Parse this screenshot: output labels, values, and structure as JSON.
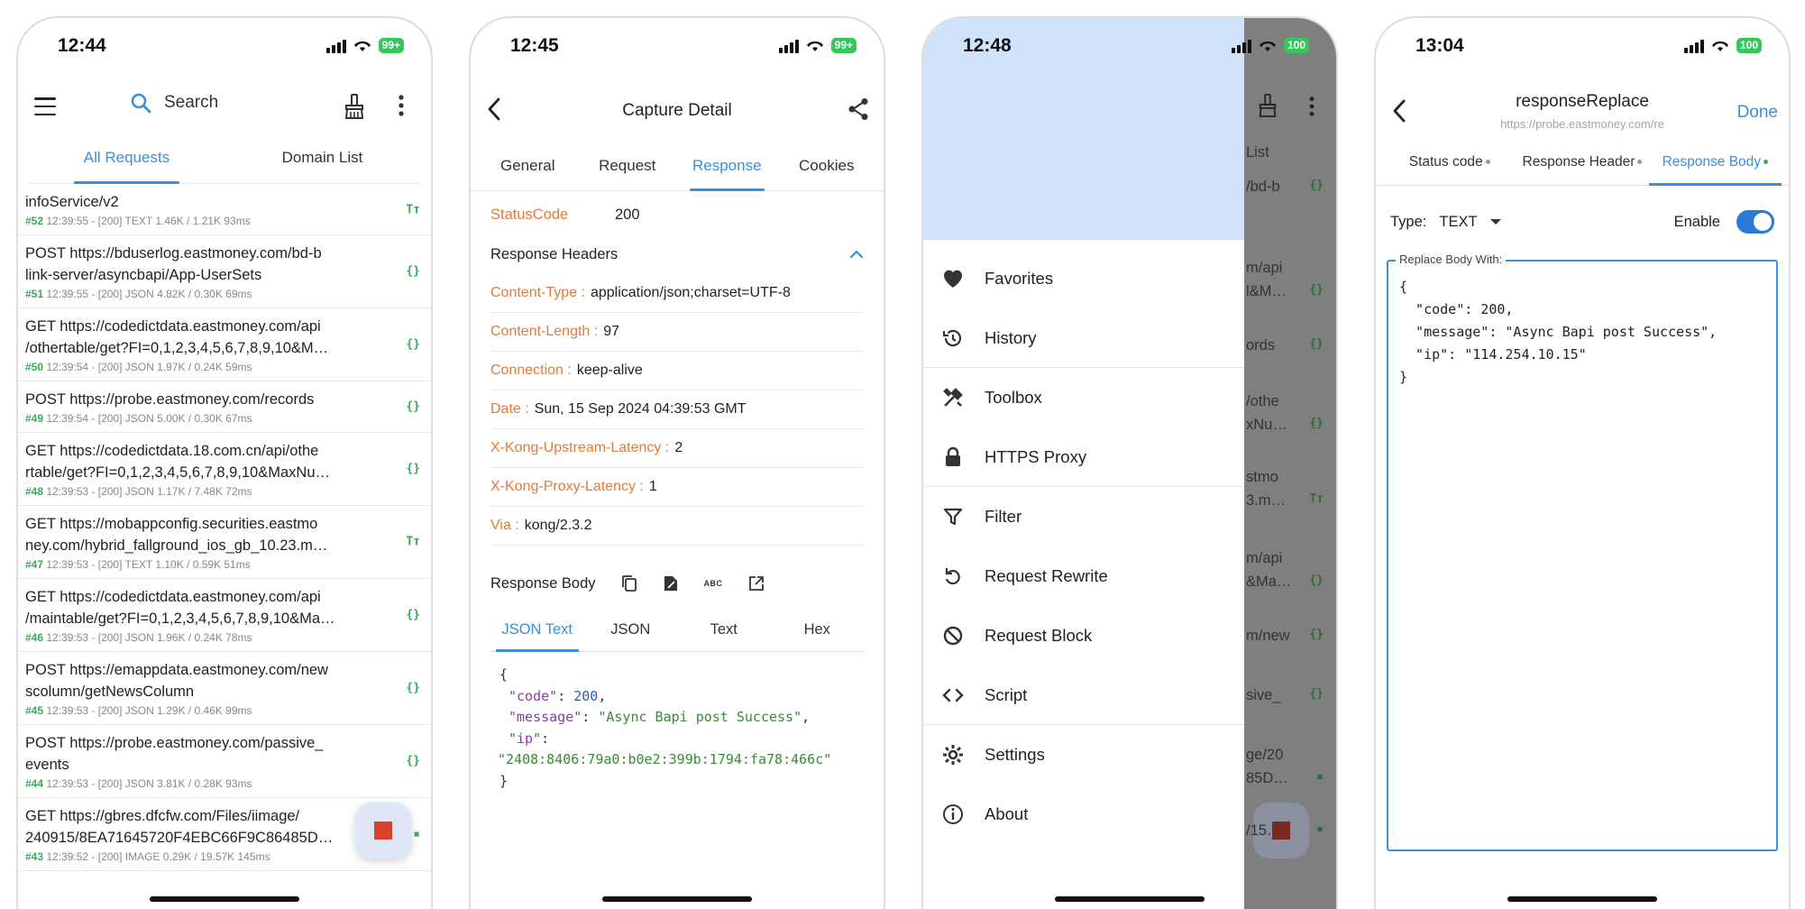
{
  "phone1": {
    "time": "12:44",
    "battery": "99+",
    "search_label": "Search",
    "tabs": [
      "All Requests",
      "Domain List"
    ],
    "requests": [
      {
        "url": "infoService/v2",
        "id": "#52",
        "meta": " 12:39:55 - [200] TEXT 1.46K / 1.21K  93ms",
        "icon": "Tт"
      },
      {
        "url": "POST https://bduserlog.eastmoney.com/bd-b\nlink-server/asyncbapi/App-UserSets",
        "id": "#51",
        "meta": " 12:39:55 - [200] JSON 4.82K / 0.30K  69ms",
        "icon": "{}"
      },
      {
        "url": "GET https://codedictdata.eastmoney.com/api\n/othertable/get?FI=0,1,2,3,4,5,6,7,8,9,10&M…",
        "id": "#50",
        "meta": " 12:39:54 - [200] JSON 1.97K / 0.24K  59ms",
        "icon": "{}"
      },
      {
        "url": "POST https://probe.eastmoney.com/records",
        "id": "#49",
        "meta": " 12:39:54 - [200] JSON 5.00K / 0.30K  67ms",
        "icon": "{}"
      },
      {
        "url": "GET https://codedictdata.18.com.cn/api/othe\nrtable/get?FI=0,1,2,3,4,5,6,7,8,9,10&MaxNu…",
        "id": "#48",
        "meta": " 12:39:53 - [200] JSON 1.17K / 7.48K  72ms",
        "icon": "{}"
      },
      {
        "url": "GET https://mobappconfig.securities.eastmo\nney.com/hybrid_fallground_ios_gb_10.23.m…",
        "id": "#47",
        "meta": " 12:39:53 - [200] TEXT 1.10K / 0.59K  51ms",
        "icon": "Tт"
      },
      {
        "url": "GET https://codedictdata.eastmoney.com/api\n/maintable/get?FI=0,1,2,3,4,5,6,7,8,9,10&Ma…",
        "id": "#46",
        "meta": " 12:39:53 - [200] JSON 1.96K / 0.24K  78ms",
        "icon": "{}"
      },
      {
        "url": "POST https://emappdata.eastmoney.com/new\nscolumn/getNewsColumn",
        "id": "#45",
        "meta": " 12:39:53 - [200] JSON 1.29K / 0.46K  99ms",
        "icon": "{}"
      },
      {
        "url": "POST https://probe.eastmoney.com/passive_\nevents",
        "id": "#44",
        "meta": " 12:39:53 - [200] JSON 3.81K / 0.28K  93ms",
        "icon": "{}"
      },
      {
        "url": "GET https://gbres.dfcfw.com/Files/iimage/\n240915/8EA71645720F4EBC66F9C86485D…",
        "id": "#43",
        "meta": " 12:39:52 - [200] IMAGE 0.29K / 19.57K  145ms",
        "icon": "▪"
      }
    ]
  },
  "phone2": {
    "time": "12:45",
    "battery": "99+",
    "title": "Capture Detail",
    "tabs": [
      "General",
      "Request",
      "Response",
      "Cookies"
    ],
    "status_key": "StatusCode",
    "status_value": "200",
    "response_headers_label": "Response Headers",
    "headers": [
      {
        "k": "Content-Type :",
        "v": "application/json;charset=UTF-8"
      },
      {
        "k": "Content-Length :",
        "v": "97"
      },
      {
        "k": "Connection :",
        "v": "keep-alive"
      },
      {
        "k": "Date :",
        "v": "Sun, 15 Sep 2024 04:39:53 GMT"
      },
      {
        "k": "X-Kong-Upstream-Latency :",
        "v": "2"
      },
      {
        "k": "X-Kong-Proxy-Latency :",
        "v": "1"
      },
      {
        "k": "Via :",
        "v": "kong/2.3.2"
      }
    ],
    "response_body_label": "Response Body",
    "abc_label": "ABC",
    "body_tabs": [
      "JSON Text",
      "JSON",
      "Text",
      "Hex"
    ],
    "json": {
      "open": "{",
      "code_key": "\"code\"",
      "code_val": "200",
      "message_key": "\"message\"",
      "message_val": "\"Async Bapi post Success\"",
      "ip_key": "\"ip\"",
      "ip_val": "\"2408:8406:79a0:b0e2:399b:1794:fa78:466c\"",
      "close": "}"
    }
  },
  "phone3": {
    "time": "12:48",
    "battery": "100",
    "menu": [
      "Favorites",
      "History",
      "Toolbox",
      "HTTPS Proxy",
      "Filter",
      "Request Rewrite",
      "Request Block",
      "Script",
      "Settings",
      "About"
    ],
    "ghost_rows": [
      "List",
      "/bd-b",
      "m/api",
      "l&M…",
      "ords",
      "/othe",
      "xNu…",
      "stmo",
      "3.m…",
      "m/api",
      "&Ma…",
      "m/new",
      "sive_",
      "ge/20",
      "85D…",
      "/15…"
    ]
  },
  "phone4": {
    "time": "13:04",
    "battery": "100",
    "title": "responseReplace",
    "subtitle": "https://probe.eastmoney.com/re",
    "done_label": "Done",
    "tabs": [
      "Status code",
      "Response Header",
      "Response Body"
    ],
    "type_label": "Type:",
    "type_value": "TEXT",
    "enable_label": "Enable",
    "enabled": true,
    "replace_legend": "Replace Body With:",
    "replace_body": "{\n  \"code\": 200,\n  \"message\": \"Async Bapi post Success\",\n  \"ip\": \"114.254.10.15\"\n}"
  }
}
